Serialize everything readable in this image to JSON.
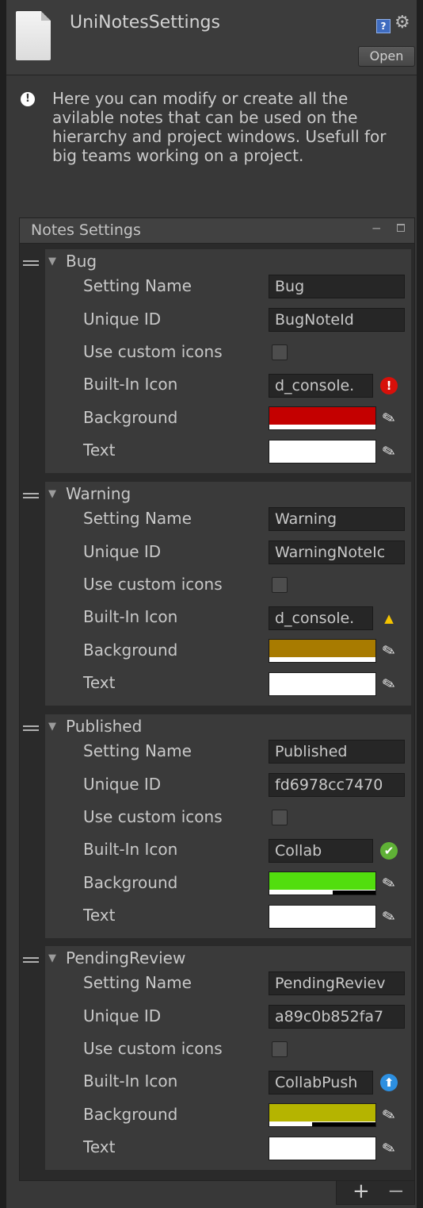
{
  "header": {
    "title": "UniNotesSettings",
    "help_icon": "?",
    "gear_icon": "⚙",
    "open_label": "Open"
  },
  "info": {
    "icon": "!",
    "text": "Here you can modify or create all the avilable notes that can be used on the hierarchy and project windows. Usefull for big teams working on a project."
  },
  "panel": {
    "title": "Notes Settings",
    "minimize": "‒",
    "add": "+",
    "remove": "−"
  },
  "labels": {
    "setting_name": "Setting Name",
    "unique_id": "Unique ID",
    "use_custom_icons": "Use custom icons",
    "built_in_icon": "Built-In Icon",
    "background": "Background",
    "text": "Text"
  },
  "notes": [
    {
      "title": "Bug",
      "setting_name": "Bug",
      "unique_id": "BugNoteId",
      "use_custom_icons": false,
      "built_in_icon": "d_console.",
      "status_icon": "error-icon",
      "status_glyph": "!",
      "status_color": "#d7100a",
      "background_color": "#c40000",
      "background_alpha": 1.0,
      "text_color": "#ffffff"
    },
    {
      "title": "Warning",
      "setting_name": "Warning",
      "unique_id": "WarningNoteIc",
      "use_custom_icons": false,
      "built_in_icon": "d_console.",
      "status_icon": "warning-icon",
      "status_glyph": "▲",
      "status_color": "#f5c400",
      "background_color": "#a87b00",
      "background_alpha": 1.0,
      "text_color": "#ffffff"
    },
    {
      "title": "Published",
      "setting_name": "Published",
      "unique_id": "fd6978cc7470⁣",
      "use_custom_icons": false,
      "built_in_icon": "Collab",
      "status_icon": "check-icon",
      "status_glyph": "✔",
      "status_color": "#5fb136",
      "background_color": "#52de0e",
      "background_alpha": 0.6,
      "text_color": "#ffffff"
    },
    {
      "title": "PendingReview",
      "setting_name": "PendingReviev",
      "unique_id": "a89c0b852fa7⁣",
      "use_custom_icons": false,
      "built_in_icon": "CollabPush",
      "status_icon": "arrow-up-icon",
      "status_glyph": "⬆",
      "status_color": "#2d8fe0",
      "background_color": "#b5b400",
      "background_alpha": 0.4,
      "text_color": "#ffffff"
    }
  ]
}
